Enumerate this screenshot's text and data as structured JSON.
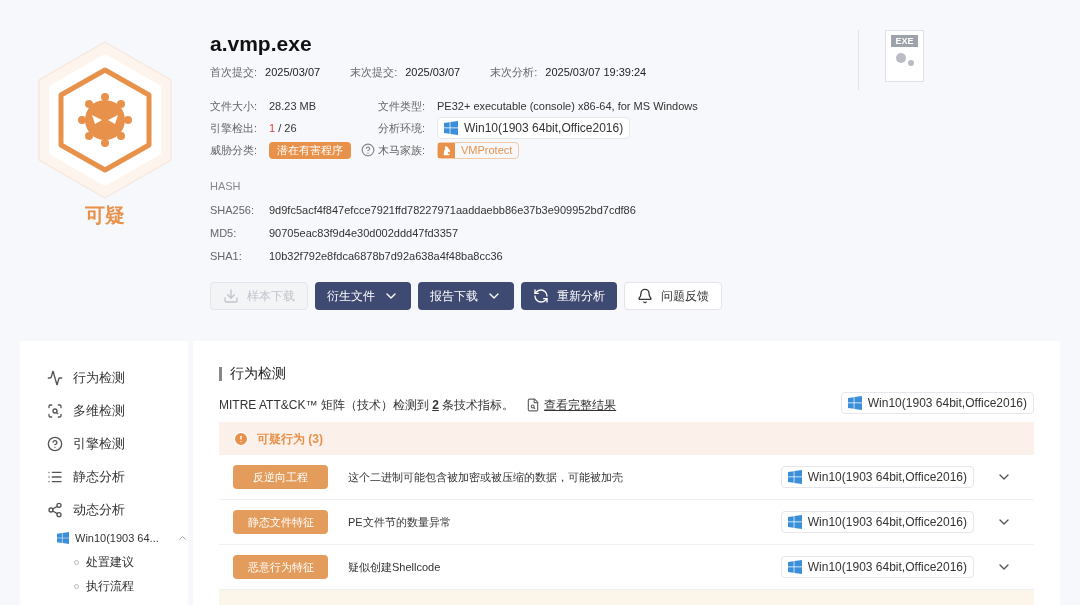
{
  "verdict": {
    "label": "可疑"
  },
  "file": {
    "name": "a.vmp.exe",
    "badge": "EXE"
  },
  "dates": [
    {
      "label": "首次提交:",
      "value": "2025/03/07"
    },
    {
      "label": "末次提交:",
      "value": "2025/03/07"
    },
    {
      "label": "末次分析:",
      "value": "2025/03/07 19:39:24"
    }
  ],
  "info": {
    "size_label": "文件大小:",
    "size": "28.23 MB",
    "type_label": "文件类型:",
    "type": "PE32+ executable (console) x86-64, for MS Windows",
    "engine_label": "引擎检出:",
    "engine_hits": "1",
    "engine_total": "/ 26",
    "env_label": "分析环境:",
    "env": "Win10(1903 64bit,Office2016)",
    "threat_label": "威胁分类:",
    "threat": "潜在有害程序",
    "family_label": "木马家族:",
    "family": "VMProtect"
  },
  "hash": {
    "title": "HASH",
    "rows": [
      {
        "label": "SHA256:",
        "value": "9d9fc5acf4f847efcce7921ffd78227971aaddaebb86e37b3e909952bd7cdf86"
      },
      {
        "label": "MD5:",
        "value": "90705eac83f9d4e30d002ddd47fd3357"
      },
      {
        "label": "SHA1:",
        "value": "10b32f792e8fdca6878b7d92a638a4f48ba8cc36"
      }
    ]
  },
  "actions": [
    {
      "kind": "download",
      "label": "样本下载",
      "disabled": true
    },
    {
      "kind": "dropdown",
      "label": "衍生文件",
      "disabled": false
    },
    {
      "kind": "dropdown",
      "label": "报告下载",
      "disabled": false
    },
    {
      "kind": "reanalyze",
      "label": "重新分析",
      "disabled": false
    },
    {
      "kind": "feedback",
      "label": "问题反馈",
      "disabled": false
    }
  ],
  "sidebar": {
    "items": [
      {
        "kind": "behavior",
        "label": "行为检测"
      },
      {
        "kind": "multi",
        "label": "多维检测"
      },
      {
        "kind": "engine",
        "label": "引擎检测"
      },
      {
        "kind": "static",
        "label": "静态分析"
      },
      {
        "kind": "dynamic",
        "label": "动态分析",
        "children": [
          {
            "label": "Win10(1903 64...",
            "expanded": true,
            "children": [
              {
                "label": "处置建议"
              },
              {
                "label": "执行流程"
              }
            ]
          }
        ]
      }
    ]
  },
  "panel": {
    "title": "行为检测",
    "summary_prefix": "MITRE ATT&CK™ 矩阵（技术）检测到",
    "summary_count": "2",
    "summary_suffix": "条技术指标。",
    "link": "查看完整结果",
    "env": "Win10(1903 64bit,Office2016)",
    "groups": [
      {
        "title": "可疑行为 (3)",
        "rows": [
          {
            "tag": "反逆向工程",
            "text": "这个二进制可能包含被加密或被压缩的数据，可能被加壳",
            "env": "Win10(1903 64bit,Office2016)",
            "expanded": false
          },
          {
            "tag": "静态文件特征",
            "text": "PE文件节的数量异常",
            "env": "Win10(1903 64bit,Office2016)",
            "expanded": false
          },
          {
            "tag": "恶意行为特征",
            "text": "疑似创建Shellcode",
            "env": "Win10(1903 64bit,Office2016)",
            "expanded": false
          }
        ]
      }
    ]
  }
}
